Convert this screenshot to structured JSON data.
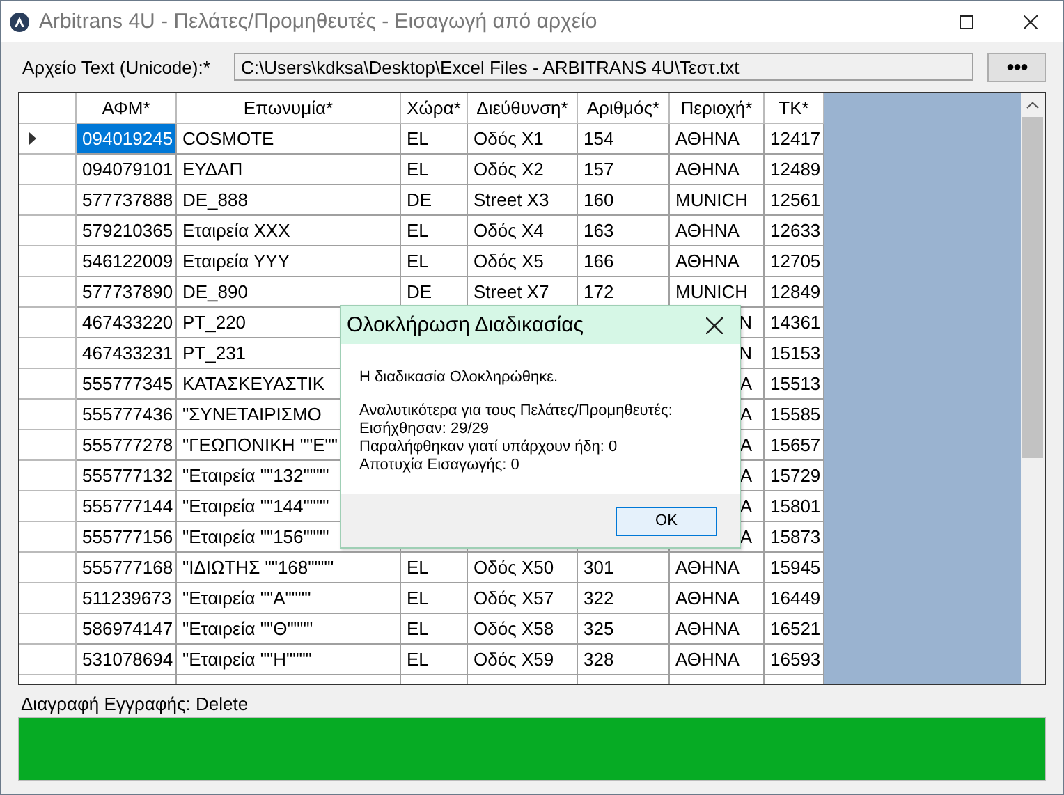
{
  "window": {
    "title": "Arbitrans 4U - Πελάτες/Προμηθευτές - Εισαγωγή από αρχείο"
  },
  "file_field": {
    "label": "Αρχείο Text (Unicode):*",
    "value": "C:\\Users\\kdksa\\Desktop\\Excel Files - ARBITRANS 4U\\Τεστ.txt",
    "browse_button": "●●●"
  },
  "grid": {
    "columns": [
      "ΑΦΜ*",
      "Επωνυμία*",
      "Χώρα*",
      "Διεύθυνση*",
      "Αριθμός*",
      "Περιοχή*",
      "ΤΚ*"
    ],
    "rows": [
      {
        "selected": true,
        "cells": [
          "094019245",
          "COSMOTE",
          "EL",
          "Οδός Χ1",
          "154",
          "ΑΘΗΝΑ",
          "12417"
        ]
      },
      {
        "selected": false,
        "cells": [
          "094079101",
          "ΕΥΔΑΠ",
          "EL",
          "Οδός Χ2",
          "157",
          "ΑΘΗΝΑ",
          "12489"
        ]
      },
      {
        "selected": false,
        "cells": [
          "577737888",
          "DE_888",
          "DE",
          "Street  X3",
          "160",
          "MUNICH",
          "12561"
        ]
      },
      {
        "selected": false,
        "cells": [
          "579210365",
          "Εταιρεία ΧΧΧ",
          "EL",
          "Οδός Χ4",
          "163",
          "ΑΘΗΝΑ",
          "12633"
        ]
      },
      {
        "selected": false,
        "cells": [
          "546122009",
          "Εταιρεία ΥΥΥ",
          "EL",
          "Οδός Χ5",
          "166",
          "ΑΘΗΝΑ",
          "12705"
        ]
      },
      {
        "selected": false,
        "cells": [
          "577737890",
          "DE_890",
          "DE",
          "Street  X7",
          "172",
          "MUNICH",
          "12849"
        ]
      },
      {
        "selected": false,
        "cells": [
          "467433220",
          "PT_220",
          null,
          null,
          null,
          "N",
          "14361"
        ]
      },
      {
        "selected": false,
        "cells": [
          "467433231",
          "PT_231",
          null,
          null,
          null,
          "N",
          "15153"
        ]
      },
      {
        "selected": false,
        "cells": [
          "555777345",
          "ΚΑΤΑΣΚΕΥΑΣΤΙΚ",
          null,
          null,
          null,
          "Α",
          "15513"
        ]
      },
      {
        "selected": false,
        "cells": [
          "555777436",
          "\"ΣΥΝΕΤΑΙΡΙΣΜΟ",
          null,
          null,
          null,
          "Α",
          "15585"
        ]
      },
      {
        "selected": false,
        "cells": [
          "555777278",
          "\"ΓΕΩΠΟΝΙΚΗ \"\"Ε\"\"",
          null,
          null,
          null,
          "Α",
          "15657"
        ]
      },
      {
        "selected": false,
        "cells": [
          "555777132",
          "\"Εταιρεία \"\"132\"\"\"\"",
          null,
          null,
          null,
          "Α",
          "15729"
        ]
      },
      {
        "selected": false,
        "cells": [
          "555777144",
          "\"Εταιρεία \"\"144\"\"\"\"",
          null,
          null,
          null,
          "Α",
          "15801"
        ]
      },
      {
        "selected": false,
        "cells": [
          "555777156",
          "\"Εταιρεία \"\"156\"\"\"\"",
          null,
          null,
          null,
          "Α",
          "15873"
        ]
      },
      {
        "selected": false,
        "cells": [
          "555777168",
          "\"ΙΔΙΩΤΗΣ \"\"168\"\"\"\"",
          "EL",
          "Οδός Χ50",
          "301",
          "ΑΘΗΝΑ",
          "15945"
        ]
      },
      {
        "selected": false,
        "cells": [
          "511239673",
          "\"Εταιρεία \"\"Α\"\"\"\"",
          "EL",
          "Οδός Χ57",
          "322",
          "ΑΘΗΝΑ",
          "16449"
        ]
      },
      {
        "selected": false,
        "cells": [
          "586974147",
          "\"Εταιρεία \"\"Θ\"\"\"\"",
          "EL",
          "Οδός Χ58",
          "325",
          "ΑΘΗΝΑ",
          "16521"
        ]
      },
      {
        "selected": false,
        "cells": [
          "531078694",
          "\"Εταιρεία \"\"Η\"\"\"\"",
          "EL",
          "Οδός Χ59",
          "328",
          "ΑΘΗΝΑ",
          "16593"
        ]
      }
    ]
  },
  "shortcut_hint": "Διαγραφή Εγγραφής: Delete",
  "progress": {
    "level": 1
  },
  "dialog": {
    "title": "Ολοκλήρωση Διαδικασίας",
    "message": "Η διαδικασία Ολοκληρώθηκε.",
    "details": [
      "Αναλυτικότερα για τους Πελάτες/Προμηθευτές:",
      "Εισήχθησαν: 29/29",
      "Παραλήφθηκαν γιατί υπάρχουν ήδη: 0",
      "Αποτυχία Εισαγωγής: 0"
    ],
    "button": "OK"
  }
}
